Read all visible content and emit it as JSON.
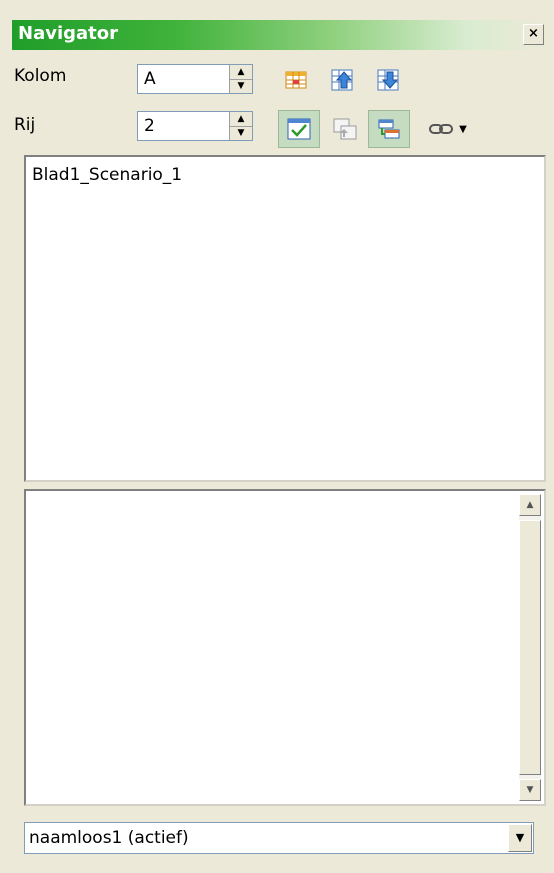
{
  "window": {
    "title": "Navigator",
    "close_glyph": "×"
  },
  "fields": {
    "column": {
      "label": "Kolom",
      "value": "A"
    },
    "row": {
      "label": "Rij",
      "value": "2"
    }
  },
  "toolbar": {
    "buttons": [
      {
        "icon": "data-range-icon",
        "pressed": false
      },
      {
        "icon": "start-icon",
        "pressed": false
      },
      {
        "icon": "end-icon",
        "pressed": false
      },
      {
        "icon": "contents-icon",
        "pressed": true
      },
      {
        "icon": "toggle-icon",
        "pressed": false
      },
      {
        "icon": "scenarios-icon",
        "pressed": true
      },
      {
        "icon": "drag-mode-icon",
        "pressed": false
      }
    ]
  },
  "scenario_list": {
    "items": [
      "Blad1_Scenario_1"
    ]
  },
  "document_select": {
    "value": "naamloos1 (actief)"
  },
  "colors": {
    "title_green": "#1f9e2a",
    "panel_bg": "#ece9d8",
    "pressed_bg": "#c6dcc2"
  }
}
